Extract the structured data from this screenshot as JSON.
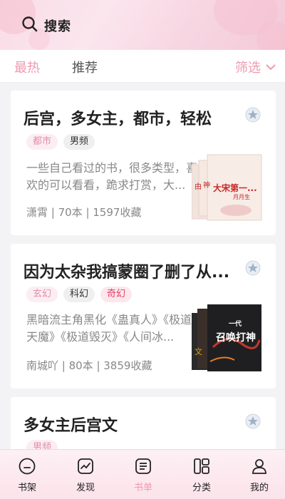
{
  "header": {
    "search_label": "搜索"
  },
  "filterbar": {
    "tabs": [
      {
        "label": "最热",
        "active": true
      },
      {
        "label": "推荐",
        "active": false
      }
    ],
    "filter_label": "筛选"
  },
  "cards": [
    {
      "title": "后宫，多女主，都市，轻松",
      "tags": [
        {
          "label": "都市",
          "style": "pink"
        },
        {
          "label": "男频",
          "style": "gray"
        }
      ],
      "desc": "一些自己看过的书，很多类型，喜欢的可以看看，跪求打赏，大...",
      "meta": "潇霄 | 70本 | 1597收藏",
      "cover_text": "大宋第一...",
      "cover_sub": "月月生"
    },
    {
      "title": "因为太杂我搞蒙圈了删了从...",
      "tags": [
        {
          "label": "玄幻",
          "style": "pink"
        },
        {
          "label": "科幻",
          "style": "gray"
        },
        {
          "label": "奇幻",
          "style": "red"
        }
      ],
      "desc": "黑暗流主角黑化《蛊真人》《极道天魔》《极道毁灭》《人间冰...",
      "meta": "南城吖 | 80本 | 3859收藏",
      "cover_text": "召唤打神",
      "cover_sub": "一代"
    },
    {
      "title": "多女主后宫文",
      "tags": [
        {
          "label": "男频",
          "style": "pink"
        }
      ]
    }
  ],
  "bottomnav": {
    "items": [
      {
        "label": "书架",
        "icon": "bookshelf-icon"
      },
      {
        "label": "发现",
        "icon": "discover-icon"
      },
      {
        "label": "书单",
        "icon": "booklist-icon",
        "active": true
      },
      {
        "label": "分类",
        "icon": "category-icon"
      },
      {
        "label": "我的",
        "icon": "profile-icon"
      }
    ]
  },
  "colors": {
    "accent": "#ef9ab0",
    "header_bg": "#f9dce6"
  }
}
